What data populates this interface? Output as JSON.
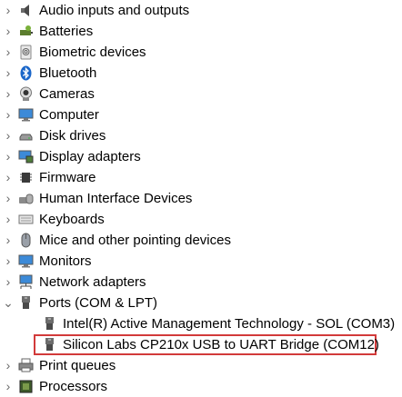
{
  "tree": {
    "nodes": [
      {
        "label": "Audio inputs and outputs",
        "icon": "speaker-icon",
        "expanded": false
      },
      {
        "label": "Batteries",
        "icon": "battery-icon",
        "expanded": false
      },
      {
        "label": "Biometric devices",
        "icon": "fingerprint-icon",
        "expanded": false
      },
      {
        "label": "Bluetooth",
        "icon": "bluetooth-icon",
        "expanded": false
      },
      {
        "label": "Cameras",
        "icon": "camera-icon",
        "expanded": false
      },
      {
        "label": "Computer",
        "icon": "monitor-icon",
        "expanded": false
      },
      {
        "label": "Disk drives",
        "icon": "disk-drive-icon",
        "expanded": false
      },
      {
        "label": "Display adapters",
        "icon": "display-adapter-icon",
        "expanded": false
      },
      {
        "label": "Firmware",
        "icon": "chip-icon",
        "expanded": false
      },
      {
        "label": "Human Interface Devices",
        "icon": "hid-icon",
        "expanded": false
      },
      {
        "label": "Keyboards",
        "icon": "keyboard-icon",
        "expanded": false
      },
      {
        "label": "Mice and other pointing devices",
        "icon": "mouse-icon",
        "expanded": false
      },
      {
        "label": "Monitors",
        "icon": "monitor-icon",
        "expanded": false
      },
      {
        "label": "Network adapters",
        "icon": "network-adapter-icon",
        "expanded": false
      },
      {
        "label": "Ports (COM & LPT)",
        "icon": "port-icon",
        "expanded": true
      },
      {
        "label": "Intel(R) Active Management Technology - SOL (COM3)",
        "icon": "port-icon",
        "child": true
      },
      {
        "label": "Silicon Labs CP210x USB to UART Bridge (COM12)",
        "icon": "port-icon",
        "child": true,
        "highlighted": true
      },
      {
        "label": "Print queues",
        "icon": "printer-icon",
        "expanded": false
      },
      {
        "label": "Processors",
        "icon": "processor-icon",
        "expanded": false
      }
    ]
  },
  "colors": {
    "highlight_border": "#d23a3a",
    "chevron": "#6b6b6b"
  }
}
